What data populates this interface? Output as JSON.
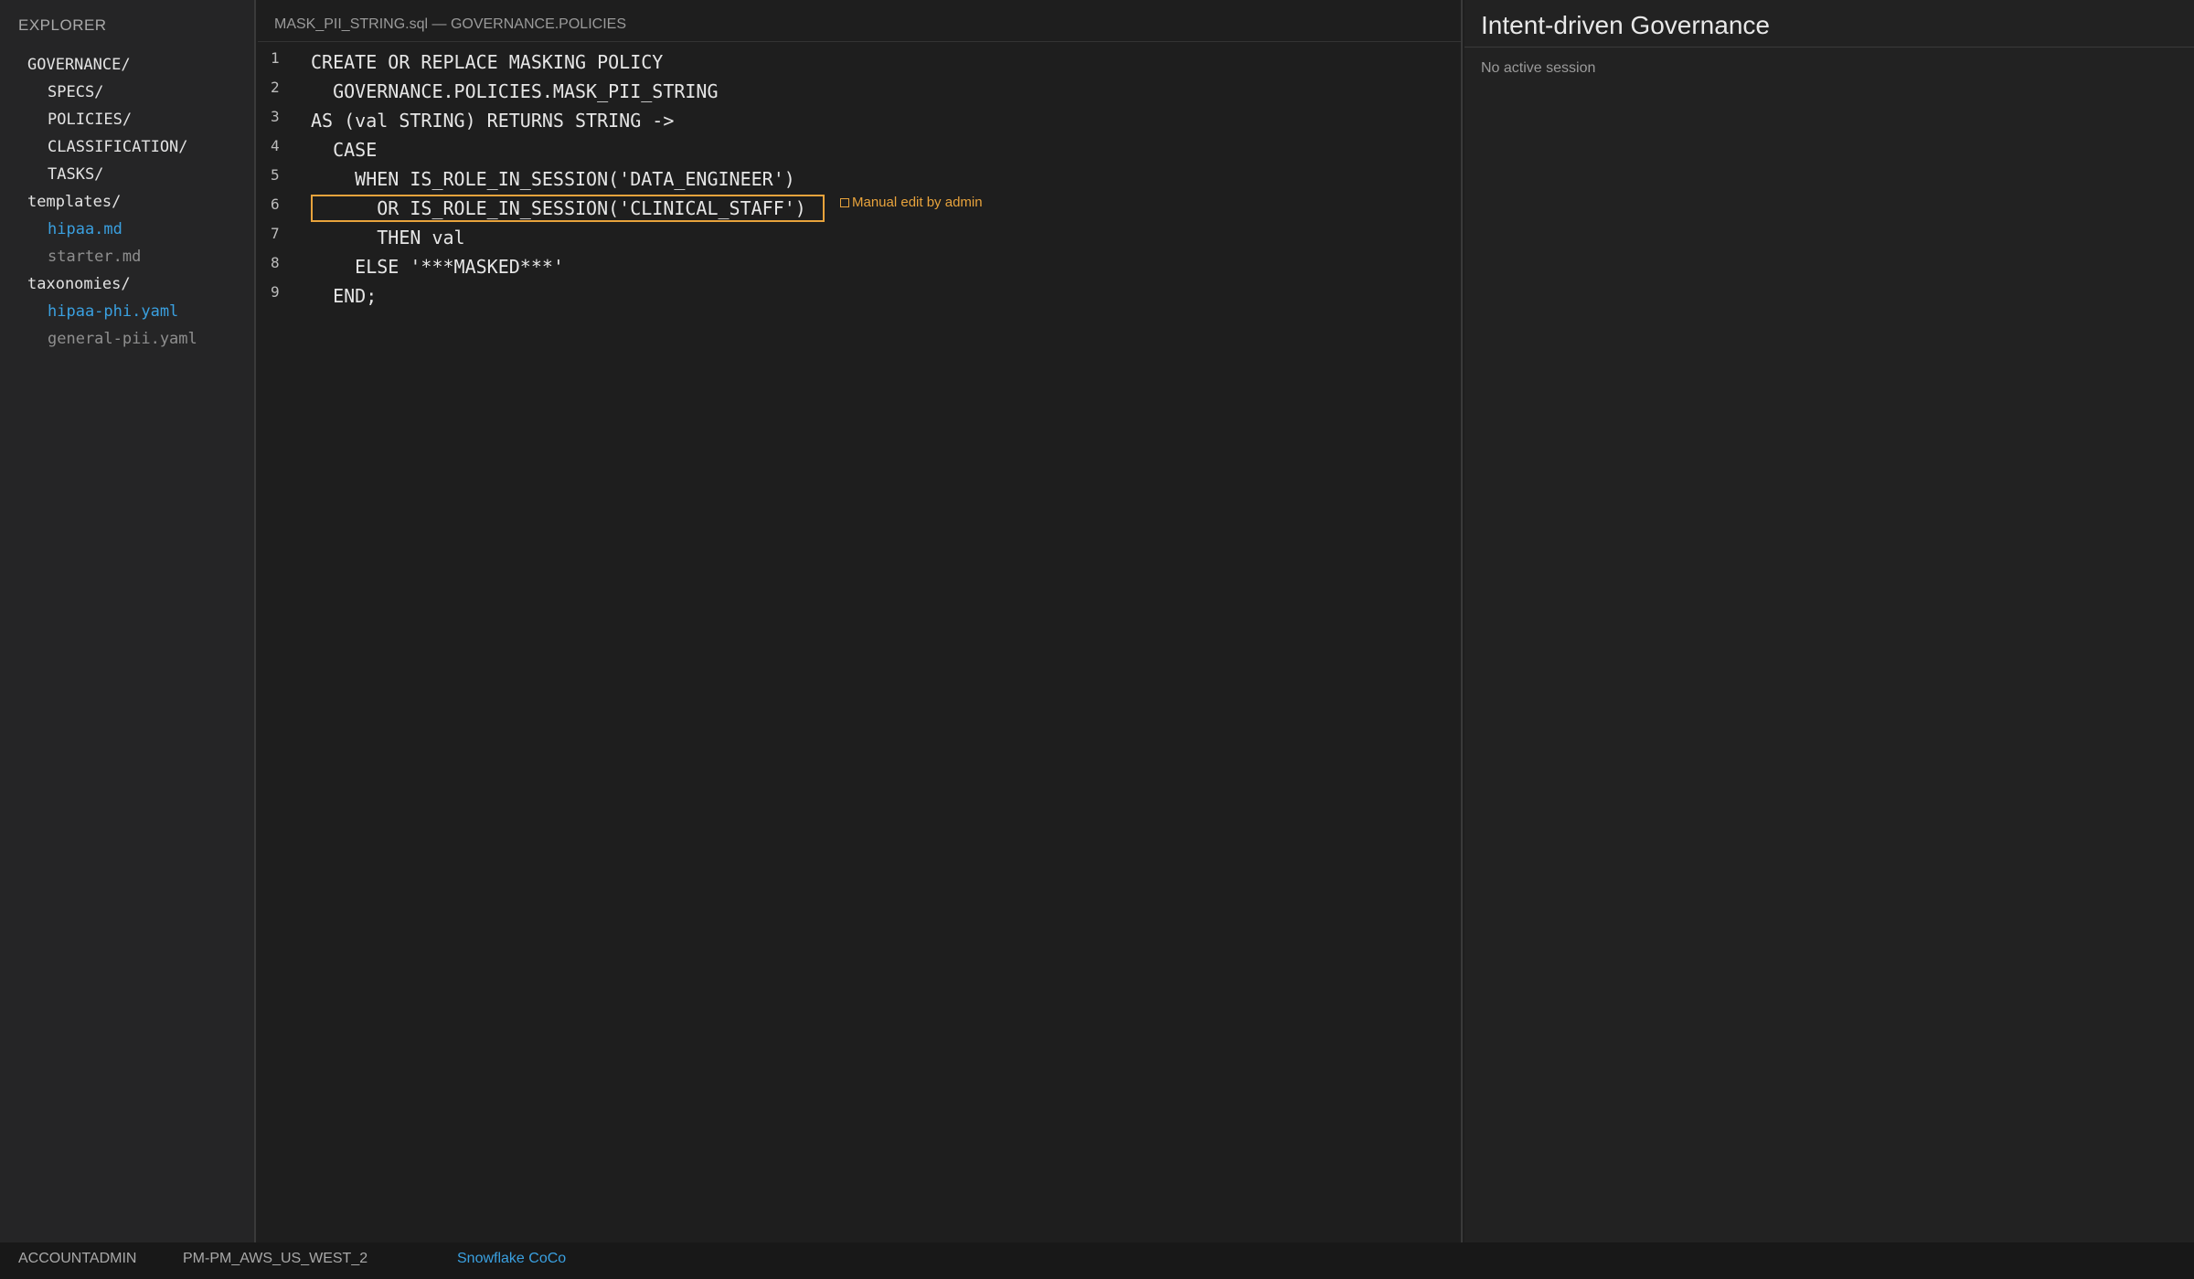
{
  "sidebar": {
    "title": "EXPLORER",
    "items": [
      {
        "label": "GOVERNANCE/",
        "level": 0
      },
      {
        "label": "SPECS/",
        "level": 1
      },
      {
        "label": "POLICIES/",
        "level": 1
      },
      {
        "label": "CLASSIFICATION/",
        "level": 1
      },
      {
        "label": "TASKS/",
        "level": 1
      },
      {
        "label": "templates/",
        "level": 0
      },
      {
        "label": "hipaa.md",
        "level": 1,
        "state": "active"
      },
      {
        "label": "starter.md",
        "level": 1,
        "state": "muted"
      },
      {
        "label": "taxonomies/",
        "level": 0
      },
      {
        "label": "hipaa-phi.yaml",
        "level": 1,
        "state": "active"
      },
      {
        "label": "general-pii.yaml",
        "level": 1,
        "state": "muted"
      }
    ]
  },
  "editor": {
    "tab_title": "MASK_PII_STRING.sql — GOVERNANCE.POLICIES",
    "lines": [
      {
        "no": "1",
        "text": "CREATE OR REPLACE MASKING POLICY"
      },
      {
        "no": "2",
        "text": "  GOVERNANCE.POLICIES.MASK_PII_STRING"
      },
      {
        "no": "3",
        "text": "AS (val STRING) RETURNS STRING ->"
      },
      {
        "no": "4",
        "text": "  CASE"
      },
      {
        "no": "5",
        "text": "    WHEN IS_ROLE_IN_SESSION('DATA_ENGINEER')"
      },
      {
        "no": "6",
        "text": "      OR IS_ROLE_IN_SESSION('CLINICAL_STAFF')"
      },
      {
        "no": "7",
        "text": "      THEN val"
      },
      {
        "no": "8",
        "text": "    ELSE '***MASKED***'"
      },
      {
        "no": "9",
        "text": "  END;"
      }
    ],
    "annotation": {
      "line": "6",
      "label": "Manual edit by admin",
      "icon": "edit-marker-icon"
    }
  },
  "panel": {
    "title": "Intent-driven Governance",
    "status": "No active session"
  },
  "statusbar": {
    "role": "ACCOUNTADMIN",
    "account": "PM-PM_AWS_US_WEST_2",
    "app_link": "Snowflake CoCo"
  },
  "colors": {
    "accent_blue": "#3aa0e0",
    "annotation_orange": "#e8a33c",
    "background": "#1e1e1e"
  }
}
